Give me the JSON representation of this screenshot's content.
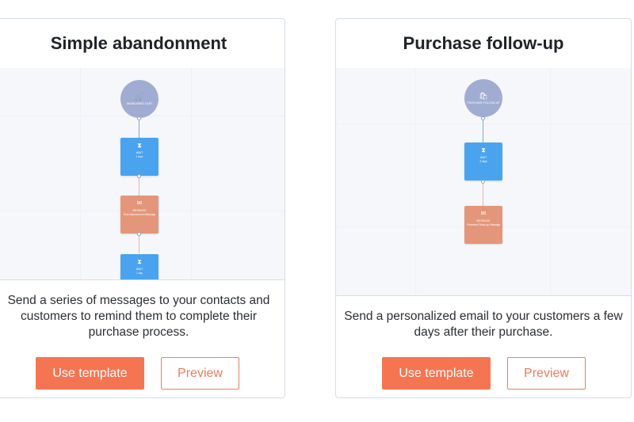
{
  "templates": [
    {
      "title": "Simple abandonment",
      "flow": {
        "trigger": {
          "icon": "cart-icon",
          "label": "ABANDONED CART"
        },
        "steps": [
          {
            "type": "wait",
            "icon": "hourglass-icon",
            "title": "WAIT",
            "sub": "1 hour"
          },
          {
            "type": "msg",
            "icon": "envelope-icon",
            "title": "MESSAGE",
            "sub": "First Abandonment Message"
          },
          {
            "type": "wait",
            "icon": "hourglass-icon",
            "title": "WAIT",
            "sub": "1 day"
          }
        ]
      },
      "description": "Send a series of messages to your contacts and customers to remind them to complete their purchase process.",
      "use_label": "Use template",
      "preview_label": "Preview"
    },
    {
      "title": "Purchase follow-up",
      "flow": {
        "trigger": {
          "icon": "bag-icon",
          "label": "PURCHASE FOLLOW-UP"
        },
        "steps": [
          {
            "type": "wait",
            "icon": "hourglass-icon",
            "title": "WAIT",
            "sub": "3 days"
          },
          {
            "type": "msg",
            "icon": "envelope-icon",
            "title": "MESSAGE",
            "sub": "Purchase Follow-up Message"
          }
        ]
      },
      "description": "Send a personalized email to your customers a few days after their purchase.",
      "use_label": "Use template",
      "preview_label": "Preview"
    }
  ]
}
